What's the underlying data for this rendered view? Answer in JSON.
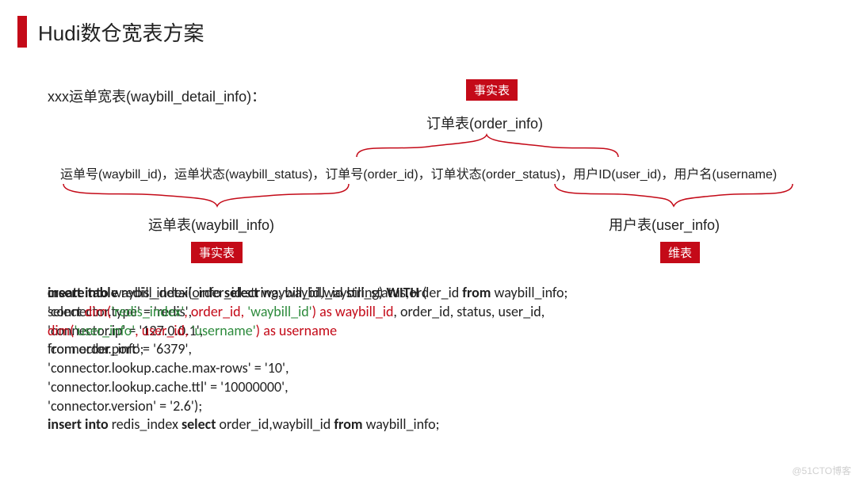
{
  "title": "Hudi数仓宽表方案",
  "subtitle": "xxx运单宽表(waybill_detail_info)：",
  "badges": {
    "top": "事实表",
    "left": "事实表",
    "right": "维表"
  },
  "tables": {
    "order": "订单表(order_info)",
    "waybill": "运单表(waybill_info)",
    "user": "用户表(user_info)"
  },
  "fields_row": "运单号(waybill_id)，运单状态(waybill_status)，订单号(order_id)，订单状态(order_status)，用户ID(user_id)，用户名(username)",
  "code": {
    "l1_a": "create table",
    "l1_b": " redis_index(order_id string, waybill_id string) ",
    "l1_c": "WITH",
    "l1_d": " (",
    "l2": "  'connector.type' = 'redis',",
    "l3": "  'connector.ip' = '127.0.0.1',",
    "l4": "  'connector.port' = '6379',",
    "l5": "  'connector.lookup.cache.max-rows' = '10',",
    "l6": "  'connector.lookup.cache.ttl' = '10000000',",
    "l7": "  'connector.version' = '2.6');",
    "l8_a": "insert into",
    "l8_b": " redis_index ",
    "l8_c": "select",
    "l8_d": " order_id,waybill_id ",
    "l8_e": "from",
    "l8_f": " waybill_info;",
    "o1_a": "insert into",
    "o1_b": " waybill_detail_info ",
    "o1_c": "select",
    "o1_d": " waybill_id,waybill_status,order_id ",
    "o1_e": "from",
    "o1_f": " waybill_info;",
    "o2_a": "select ",
    "o2_b": "dim",
    "o2_c": "(",
    "o2_d": "'redis_index'",
    "o2_e": ", order_id, ",
    "o2_f": "'waybill_id'",
    "o2_g": ") as waybill_id",
    "o2_h": ", order_id, status, user_id,",
    "o3_a": "dim",
    "o3_b": "(",
    "o3_c": "'user_info'",
    "o3_d": ", user_id, ",
    "o3_e": "'username'",
    "o3_f": ") as username",
    "o4": "from order_info;"
  },
  "watermark": "@51CTO博客"
}
